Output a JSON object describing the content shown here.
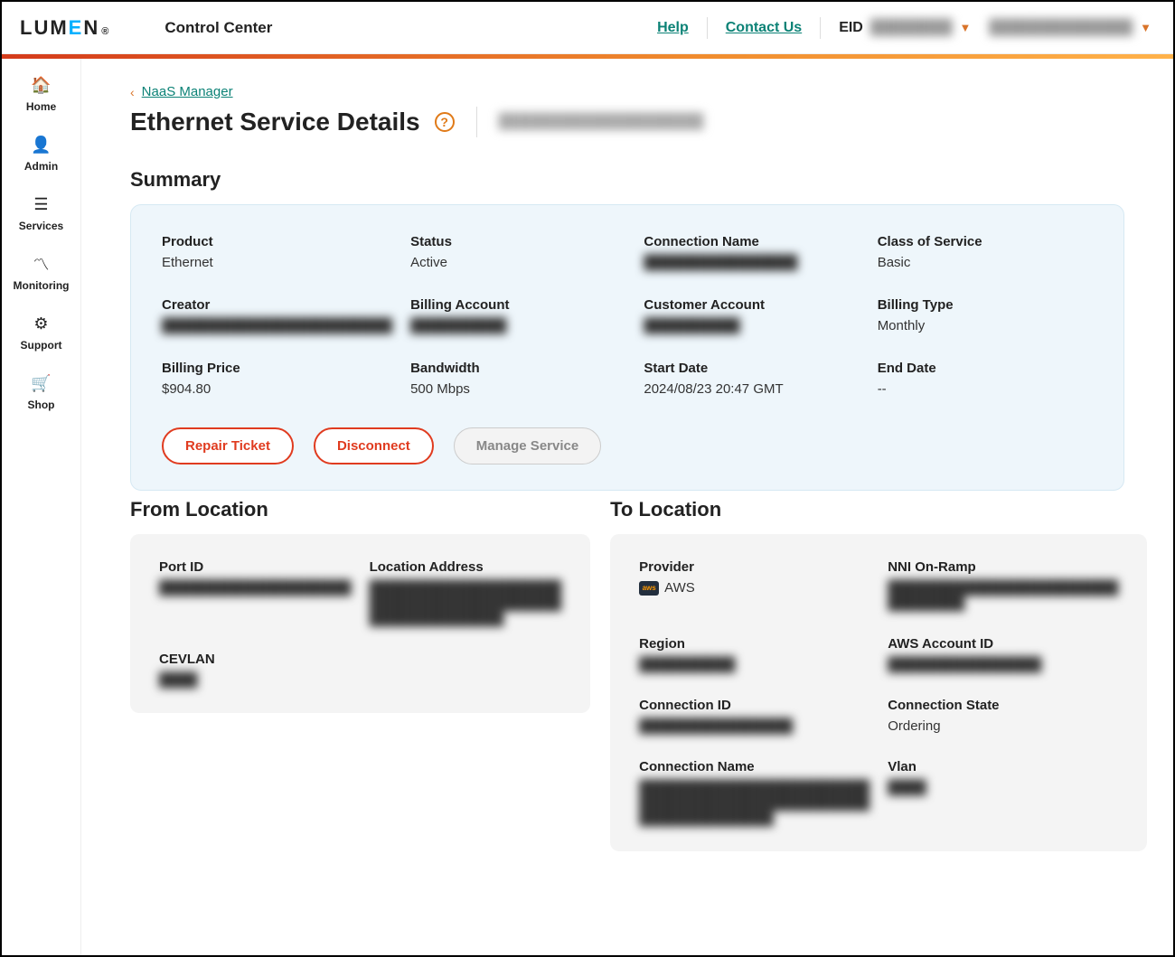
{
  "header": {
    "logo_text": "LUMEN",
    "app_title": "Control Center",
    "help": "Help",
    "contact": "Contact Us",
    "eid_label": "EID",
    "eid_value_redacted": "████████",
    "account_redacted": "██████████████"
  },
  "sidebar": [
    {
      "name": "home",
      "label": "Home",
      "icon": "🏠"
    },
    {
      "name": "admin",
      "label": "Admin",
      "icon": "👤"
    },
    {
      "name": "services",
      "label": "Services",
      "icon": "☰"
    },
    {
      "name": "monitoring",
      "label": "Monitoring",
      "icon": "〽"
    },
    {
      "name": "support",
      "label": "Support",
      "icon": "⚙"
    },
    {
      "name": "shop",
      "label": "Shop",
      "icon": "🛒"
    }
  ],
  "breadcrumb": {
    "parent": "NaaS Manager"
  },
  "page": {
    "title": "Ethernet Service Details",
    "subtitle_redacted": "████████████████████"
  },
  "summary": {
    "title": "Summary",
    "fields": {
      "product": {
        "label": "Product",
        "value": "Ethernet"
      },
      "status": {
        "label": "Status",
        "value": "Active"
      },
      "connection_name": {
        "label": "Connection Name",
        "value_redacted": "████████████████"
      },
      "class_of_service": {
        "label": "Class of Service",
        "value": "Basic"
      },
      "creator": {
        "label": "Creator",
        "value_redacted": "████████████████████████"
      },
      "billing_account": {
        "label": "Billing Account",
        "value_redacted": "██████████"
      },
      "customer_account": {
        "label": "Customer Account",
        "value_redacted": "██████████"
      },
      "billing_type": {
        "label": "Billing Type",
        "value": "Monthly"
      },
      "billing_price": {
        "label": "Billing Price",
        "value": "$904.80"
      },
      "bandwidth": {
        "label": "Bandwidth",
        "value": "500 Mbps"
      },
      "start_date": {
        "label": "Start Date",
        "value": "2024/08/23 20:47 GMT"
      },
      "end_date": {
        "label": "End Date",
        "value": "--"
      }
    },
    "buttons": {
      "repair": "Repair Ticket",
      "disconnect": "Disconnect",
      "manage": "Manage Service"
    }
  },
  "from_location": {
    "title": "From Location",
    "fields": {
      "port_id": {
        "label": "Port ID",
        "value_redacted": "████████████████████"
      },
      "address": {
        "label": "Location Address",
        "value_redacted": "████████████████████\n████████████████████\n██████████████"
      },
      "cevlan": {
        "label": "CEVLAN",
        "value_redacted": "████"
      }
    }
  },
  "to_location": {
    "title": "To Location",
    "fields": {
      "provider": {
        "label": "Provider",
        "value": "AWS"
      },
      "nni": {
        "label": "NNI On-Ramp",
        "value_redacted": "████████████████████████\n████████"
      },
      "region": {
        "label": "Region",
        "value_redacted": "██████████"
      },
      "aws_account": {
        "label": "AWS Account ID",
        "value_redacted": "████████████████"
      },
      "connection_id": {
        "label": "Connection ID",
        "value_redacted": "████████████████"
      },
      "connection_state": {
        "label": "Connection State",
        "value": "Ordering"
      },
      "connection_name": {
        "label": "Connection Name",
        "value_redacted": "████████████████████████\n████████████████████████\n██████████████"
      },
      "vlan": {
        "label": "Vlan",
        "value_redacted": "████"
      }
    }
  }
}
